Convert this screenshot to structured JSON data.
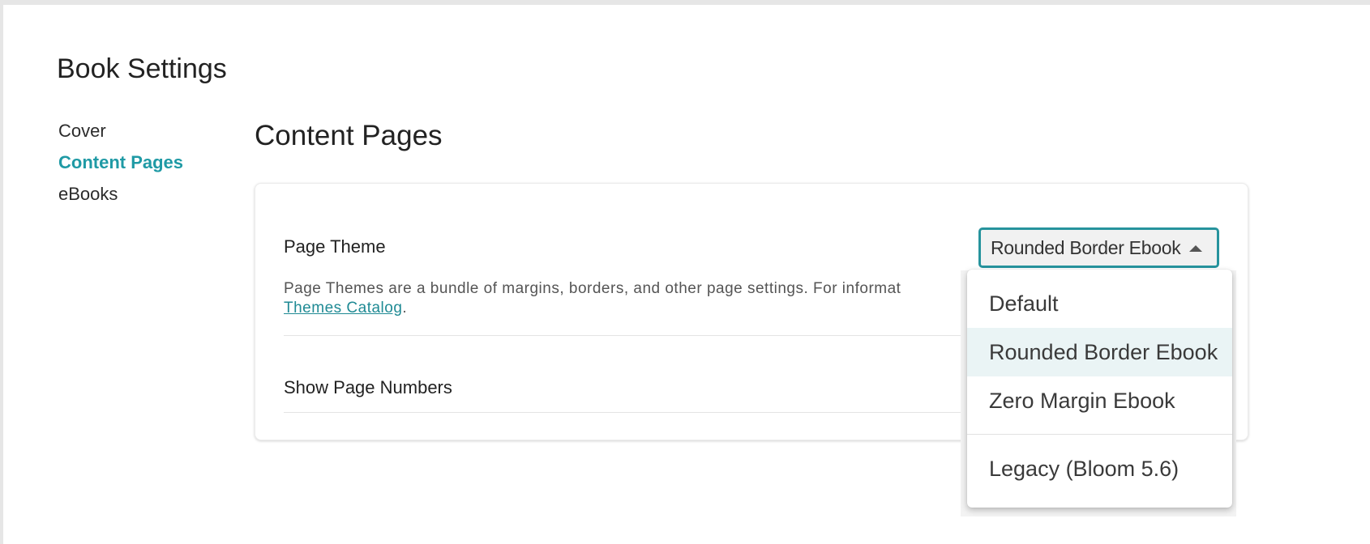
{
  "page": {
    "title": "Book Settings"
  },
  "nav": {
    "items": [
      {
        "label": "Cover",
        "active": false
      },
      {
        "label": "Content Pages",
        "active": true
      },
      {
        "label": "eBooks",
        "active": false
      }
    ]
  },
  "section": {
    "title": "Content Pages"
  },
  "page_theme": {
    "label": "Page Theme",
    "description_text": "Page Themes are a bundle of margins, borders, and other page settings. For informat",
    "description_link": "Themes Catalog",
    "description_suffix": ".",
    "selected_value": "Rounded Border Ebook",
    "options": [
      {
        "label": "Default"
      },
      {
        "label": "Rounded Border Ebook",
        "selected": true
      },
      {
        "label": "Zero Margin Ebook"
      },
      {
        "label": "Legacy (Bloom 5.6)"
      }
    ]
  },
  "page_numbers": {
    "label": "Show  Page Numbers"
  },
  "colors": {
    "accent": "#1f9aa5",
    "select_border": "#26939d",
    "selected_option_bg": "#eaf4f5"
  }
}
